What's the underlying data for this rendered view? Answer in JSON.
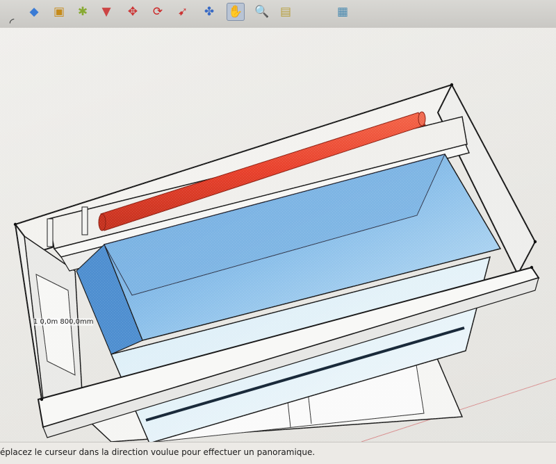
{
  "toolbar": {
    "tools": [
      {
        "name": "arc-tool-icon",
        "glyph": "◜"
      },
      {
        "name": "paint-bucket-icon",
        "glyph": "◆"
      },
      {
        "name": "push-pull-icon",
        "glyph": "▣"
      },
      {
        "name": "offset-icon",
        "glyph": "✱"
      },
      {
        "name": "follow-me-icon",
        "glyph": "▼"
      },
      {
        "name": "move-icon",
        "glyph": "✥"
      },
      {
        "name": "rotate-icon",
        "glyph": "⟳"
      },
      {
        "name": "scale-icon",
        "glyph": "➹"
      },
      {
        "name": "orbit-icon",
        "glyph": "✤"
      },
      {
        "name": "pan-icon",
        "glyph": "✋"
      },
      {
        "name": "zoom-icon",
        "glyph": "🔍"
      },
      {
        "name": "zoom-window-icon",
        "glyph": "▤"
      },
      {
        "name": "zoom-extents-icon",
        "glyph": "▦"
      }
    ],
    "active_tool": "pan-icon"
  },
  "viewport": {
    "dimension_label": "1 0,0m 800,0mm"
  },
  "colors": {
    "water": "#6fa9de",
    "red_pipe": "#e8412c",
    "frame": "#f3f2ef",
    "edge": "#1a1a1a"
  },
  "status": {
    "text": "éplacez le curseur dans la direction voulue pour effectuer un panoramique."
  }
}
